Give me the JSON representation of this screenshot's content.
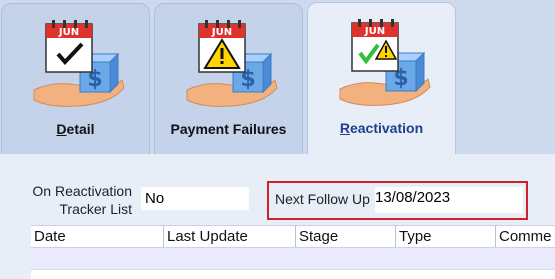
{
  "tabs": [
    {
      "label_ul": "D",
      "label_rest": "etail",
      "icon": "calendar-checkmark-money-icon"
    },
    {
      "label_pre": "Payment Failures",
      "icon": "calendar-warning-money-icon"
    },
    {
      "label_ul": "R",
      "label_rest": "eactivation",
      "icon": "calendar-check-warning-money-icon"
    }
  ],
  "calendar_month": "JUN",
  "form": {
    "reactivation_label_line1": "On Reactivation",
    "reactivation_label_line2": "Tracker List",
    "reactivation_value": "No",
    "followup_label": "Next Follow Up",
    "followup_value": "13/08/2023"
  },
  "grid": {
    "columns": [
      "Date",
      "Last Update",
      "Stage",
      "Type",
      "Comme"
    ]
  },
  "colors": {
    "highlight_border": "#d0202c",
    "active_tab_text": "#1f3f8c"
  }
}
